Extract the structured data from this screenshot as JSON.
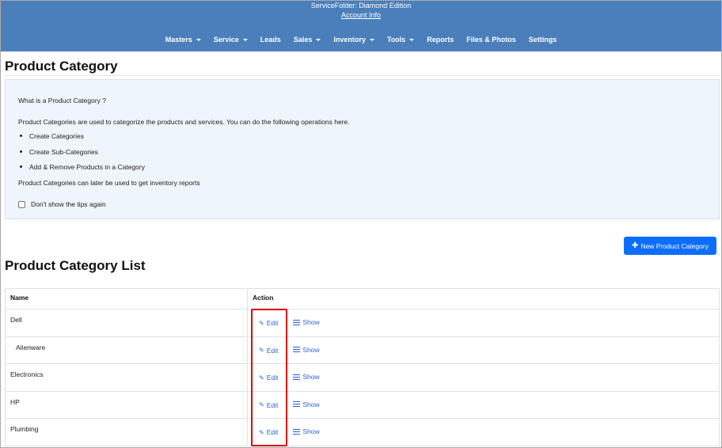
{
  "header": {
    "brand": "ServiceFolder: Diamond Edition",
    "account_link": "Account Info",
    "nav": [
      {
        "label": "Masters",
        "dropdown": true
      },
      {
        "label": "Service",
        "dropdown": true
      },
      {
        "label": "Leads",
        "dropdown": false
      },
      {
        "label": "Sales",
        "dropdown": true
      },
      {
        "label": "Inventory",
        "dropdown": true
      },
      {
        "label": "Tools",
        "dropdown": true
      },
      {
        "label": "Reports",
        "dropdown": false
      },
      {
        "label": "Files & Photos",
        "dropdown": false
      },
      {
        "label": "Settings",
        "dropdown": false
      }
    ]
  },
  "page_title": "Product Category",
  "tips": {
    "question": "What is a Product Category ?",
    "description": "Product Categories are used to categorize the products and services. You can do the following operations here.",
    "items": [
      "Create Categories",
      "Create Sub-Categories",
      "Add & Remove Products in a Category"
    ],
    "later": "Product Categories can later be used to get inventory reports",
    "checkbox_label": "Don't show the tips again"
  },
  "new_button": "New Product Category",
  "list_title": "Product Category List",
  "table": {
    "headers": {
      "name": "Name",
      "action": "Action"
    },
    "edit_label": "Edit",
    "show_label": "Show",
    "rows": [
      {
        "name": "Dell",
        "sub": false
      },
      {
        "name": "Alienware",
        "sub": true
      },
      {
        "name": "Electronics",
        "sub": false
      },
      {
        "name": "HP",
        "sub": false
      },
      {
        "name": "Plumbing",
        "sub": false
      }
    ]
  },
  "colors": {
    "header": "#4a7fbc",
    "accent": "#0d6efd",
    "highlight": "#e00000"
  }
}
